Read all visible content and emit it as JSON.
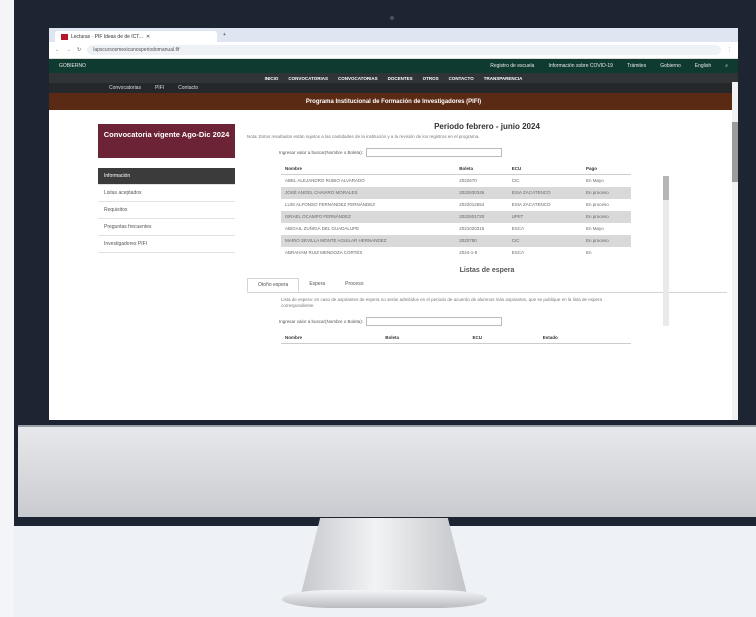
{
  "browser": {
    "tab_title": "Lecturas · PIF Ideas de de ICT...",
    "url": "lapscursosmexicanosperiodomanual.fif"
  },
  "gov_bar": {
    "brand": "GOBIERNO",
    "links": [
      "Registro de escuela",
      "Información sobre COVID-19",
      "Trámites",
      "Gobierno",
      "English"
    ]
  },
  "menu1": [
    "INICIO",
    "CONVOCATORIAS",
    "CONVOCATORIAS",
    "DOCENTES",
    "OTROS",
    "CONTACTO",
    "TRANSPARENCIA"
  ],
  "menu2": [
    "Convocatorias",
    "PIFI",
    "Contacto"
  ],
  "banner": "Programa Institucional de Formación de Investigadores (PIFI)",
  "sidebar": {
    "convocatoria": "Convocatoria vigente Ago-Dic 2024",
    "items": [
      "Información",
      "Listas aceptados",
      "Requisitos",
      "Preguntas frecuentes",
      "Investigadores PIFI"
    ]
  },
  "main": {
    "period_title": "Periodo febrero - junio 2024",
    "note": "Nota: Estos resultados están sujetos a las cantidades de la institución y a la revisión de los registros en el programa.",
    "search_label": "Ingresar valor a buscar(Nombre o Boleta):",
    "columns": [
      "Nombre",
      "Boleta",
      "ECU",
      "Pago"
    ],
    "rows": [
      [
        "ABEL ALEJANDRO RUBIO ALVARADO",
        "2022670",
        "CIC",
        "En Mayo"
      ],
      [
        "JOSÉ ANGEL CHAVIRO MORALES",
        "2022630346",
        "ESIA ZACATENCO",
        "En proceso"
      ],
      [
        "LUIS ALFONSO FERNÁNDEZ FERNÁNDEZ",
        "2022012554",
        "ESIA ZACATENCO",
        "En proceso"
      ],
      [
        "ISRAEL OCAMPO FERNÁNDEZ",
        "2022601720",
        "UPIIT",
        "En proceso"
      ],
      [
        "ABIGAIL ZUÑIGA DEL GUADALUPE",
        "2021020315",
        "ESCA",
        "En Mayo"
      ],
      [
        "MARIO SEVILLA MONTE AGUILAR HERNANDEZ",
        "2020780",
        "CIC",
        "En proceso"
      ],
      [
        "ABRAHAM RUIZ MENDOZA CORTÉS",
        "2024-1-8",
        "ESCA",
        "En"
      ]
    ],
    "lists_title": "Listas de espera",
    "wait_tabs": [
      "Otoño espera",
      "Espera",
      "Proceso"
    ],
    "wait_desc": "Lista de espera: en caso de aspirantes de espera no serán admitidos en el periodo de acuerdo de alumnos más aspirantes, que se publique en la lista de espera correspondiente.",
    "wait_search_label": "Ingresar valor a buscar(Nombre o Boleta):",
    "wait_columns": [
      "Nombre",
      "Boleta",
      "ECU",
      "Estado"
    ]
  },
  "colors": {
    "gov_green": "#0f3a2f",
    "banner": "#5a2a14",
    "guinda": "#6c2335",
    "frame": "#1e2532"
  }
}
